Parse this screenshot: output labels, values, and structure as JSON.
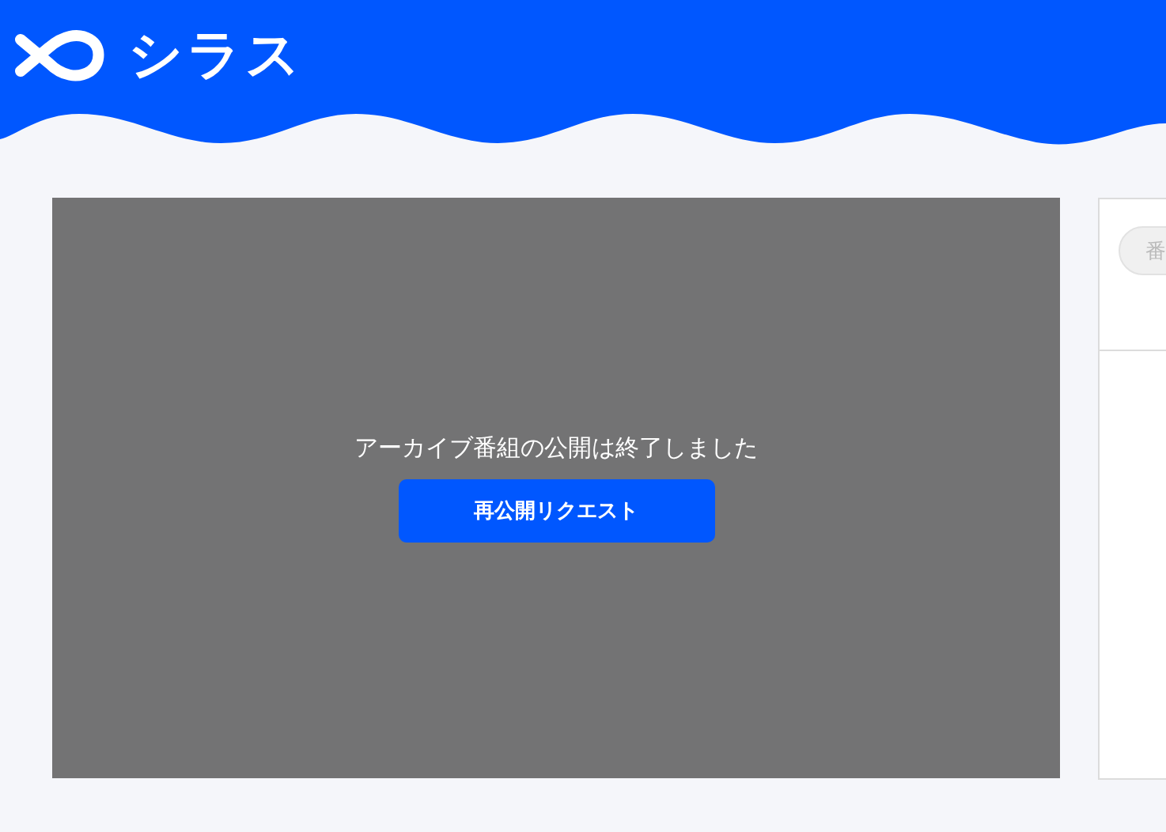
{
  "header": {
    "logo_text": "シラス"
  },
  "player": {
    "message": "アーカイブ番組の公開は終了しました",
    "button": "再公開リクエスト"
  },
  "side_panel": {
    "tab": "番"
  }
}
